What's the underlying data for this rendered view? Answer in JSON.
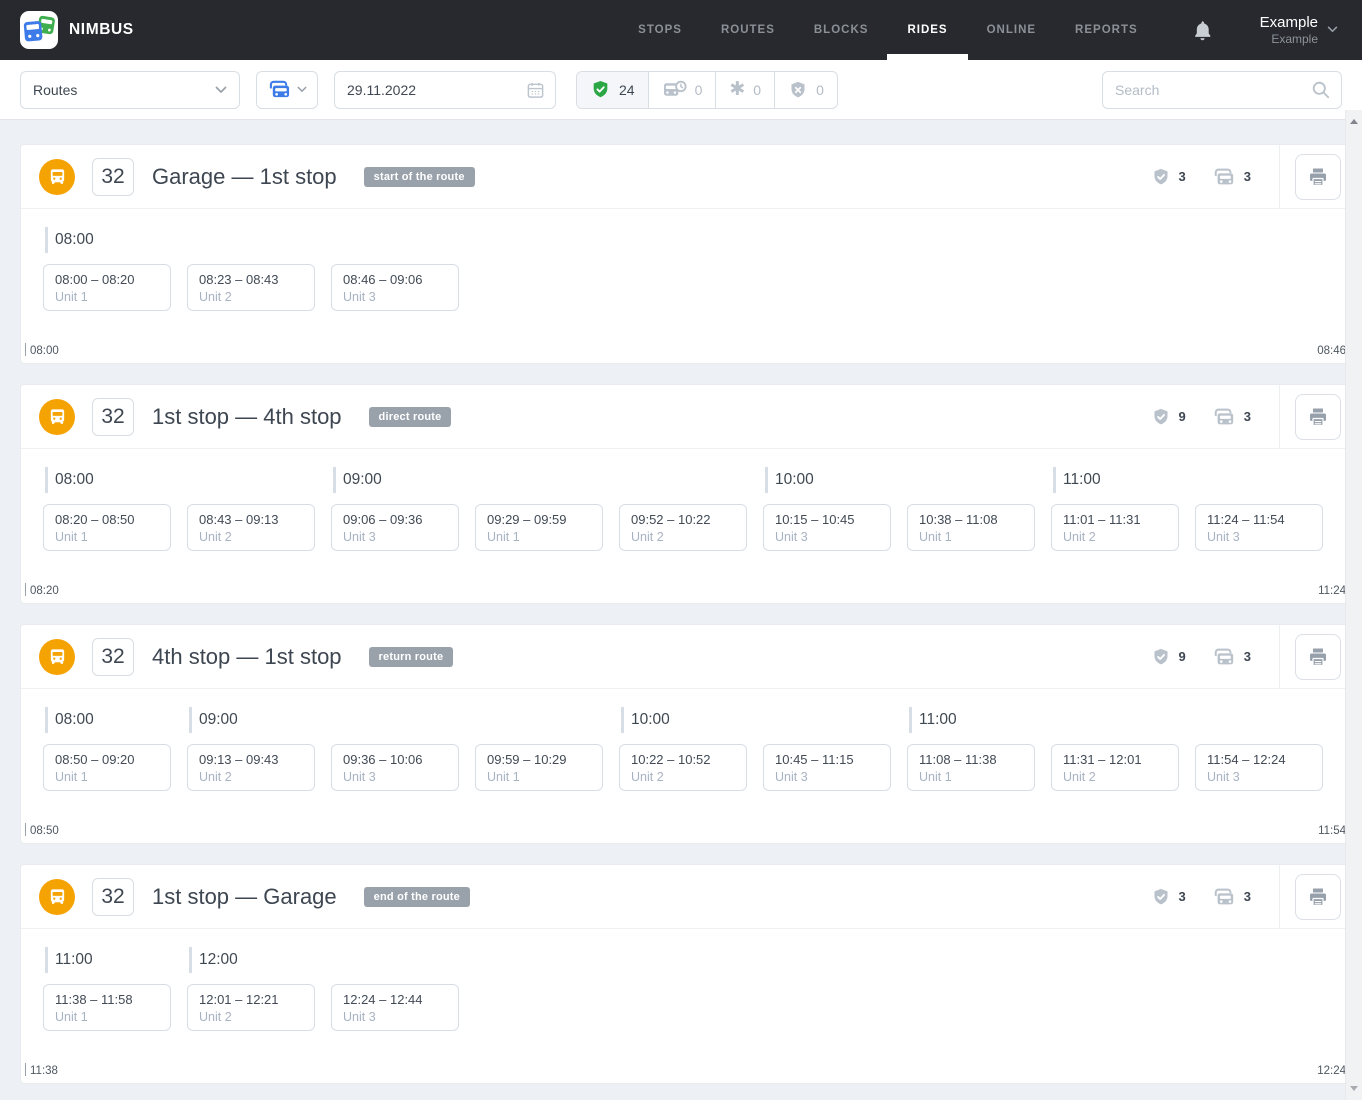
{
  "colors": {
    "accent_orange": "#F5A303",
    "accent_green": "#2BA745",
    "accent_blue": "#3D7CE8",
    "badge_gray": "#99A1AB",
    "header_dark": "#28292E"
  },
  "header": {
    "brand": "NIMBUS",
    "nav": [
      {
        "label": "STOPS",
        "active": false
      },
      {
        "label": "ROUTES",
        "active": false
      },
      {
        "label": "BLOCKS",
        "active": false
      },
      {
        "label": "RIDES",
        "active": true
      },
      {
        "label": "ONLINE",
        "active": false
      },
      {
        "label": "REPORTS",
        "active": false
      }
    ],
    "notifications_icon": "bell-icon",
    "user": {
      "name": "Example",
      "subtitle": "Example"
    }
  },
  "filters": {
    "route_filter_value": "Routes",
    "vehicle_filter_icon": "bus-fleet-icon",
    "date_value": "29.11.2022",
    "statuses": [
      {
        "icon": "shield-check-icon",
        "count": "24",
        "active": true
      },
      {
        "icon": "bus-clock-icon",
        "count": "0",
        "active": false
      },
      {
        "icon": "asterisk-icon",
        "count": "0",
        "active": false
      },
      {
        "icon": "shield-x-icon",
        "count": "0",
        "active": false
      }
    ],
    "search_placeholder": "Search"
  },
  "sections": [
    {
      "route_icon": "bus-icon",
      "route_number": "32",
      "title": "Garage — 1st stop",
      "badge": "start of the route",
      "rides_count": "3",
      "vehicles_count": "3",
      "start_time": "08:00",
      "end_time": "08:46",
      "groups": [
        {
          "hour": "08:00",
          "rides": [
            {
              "time": "08:00 – 08:20",
              "unit": "Unit 1"
            },
            {
              "time": "08:23 – 08:43",
              "unit": "Unit 2"
            },
            {
              "time": "08:46 – 09:06",
              "unit": "Unit 3"
            }
          ]
        }
      ]
    },
    {
      "route_icon": "bus-icon",
      "route_number": "32",
      "title": "1st stop — 4th stop",
      "badge": "direct route",
      "rides_count": "9",
      "vehicles_count": "3",
      "start_time": "08:20",
      "end_time": "11:24",
      "groups": [
        {
          "hour": "08:00",
          "rides": [
            {
              "time": "08:20 – 08:50",
              "unit": "Unit 1"
            },
            {
              "time": "08:43 – 09:13",
              "unit": "Unit 2"
            }
          ]
        },
        {
          "hour": "09:00",
          "rides": [
            {
              "time": "09:06 – 09:36",
              "unit": "Unit 3"
            },
            {
              "time": "09:29 – 09:59",
              "unit": "Unit 1"
            },
            {
              "time": "09:52 – 10:22",
              "unit": "Unit 2"
            }
          ]
        },
        {
          "hour": "10:00",
          "rides": [
            {
              "time": "10:15 – 10:45",
              "unit": "Unit 3"
            },
            {
              "time": "10:38 – 11:08",
              "unit": "Unit 1"
            }
          ]
        },
        {
          "hour": "11:00",
          "rides": [
            {
              "time": "11:01 – 11:31",
              "unit": "Unit 2"
            },
            {
              "time": "11:24 – 11:54",
              "unit": "Unit 3"
            }
          ]
        }
      ]
    },
    {
      "route_icon": "bus-icon",
      "route_number": "32",
      "title": "4th stop — 1st stop",
      "badge": "return route",
      "rides_count": "9",
      "vehicles_count": "3",
      "start_time": "08:50",
      "end_time": "11:54",
      "groups": [
        {
          "hour": "08:00",
          "rides": [
            {
              "time": "08:50 – 09:20",
              "unit": "Unit 1"
            }
          ]
        },
        {
          "hour": "09:00",
          "rides": [
            {
              "time": "09:13 – 09:43",
              "unit": "Unit 2"
            },
            {
              "time": "09:36 – 10:06",
              "unit": "Unit 3"
            },
            {
              "time": "09:59 – 10:29",
              "unit": "Unit 1"
            }
          ]
        },
        {
          "hour": "10:00",
          "rides": [
            {
              "time": "10:22 – 10:52",
              "unit": "Unit 2"
            },
            {
              "time": "10:45 – 11:15",
              "unit": "Unit 3"
            }
          ]
        },
        {
          "hour": "11:00",
          "rides": [
            {
              "time": "11:08 – 11:38",
              "unit": "Unit 1"
            },
            {
              "time": "11:31 – 12:01",
              "unit": "Unit 2"
            },
            {
              "time": "11:54 – 12:24",
              "unit": "Unit 3"
            }
          ]
        }
      ]
    },
    {
      "route_icon": "bus-icon",
      "route_number": "32",
      "title": "1st stop — Garage",
      "badge": "end of the route",
      "rides_count": "3",
      "vehicles_count": "3",
      "start_time": "11:38",
      "end_time": "12:24",
      "groups": [
        {
          "hour": "11:00",
          "rides": [
            {
              "time": "11:38 – 11:58",
              "unit": "Unit 1"
            }
          ]
        },
        {
          "hour": "12:00",
          "rides": [
            {
              "time": "12:01 – 12:21",
              "unit": "Unit 2"
            },
            {
              "time": "12:24 – 12:44",
              "unit": "Unit 3"
            }
          ]
        }
      ]
    }
  ]
}
